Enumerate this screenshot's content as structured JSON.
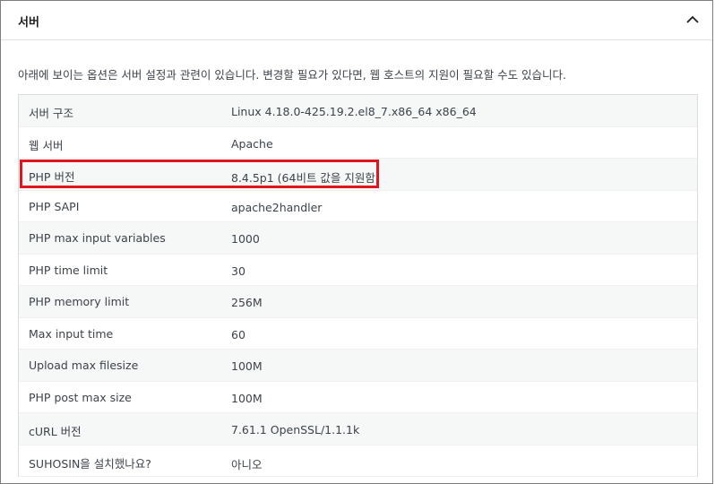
{
  "panel": {
    "title": "서버",
    "toggle_icon": "chevron-up-icon",
    "description": "아래에 보이는 옵션은 서버 설정과 관련이 있습니다. 변경할 필요가 있다면, 웹 호스트의 지원이 필요할 수도 있습니다."
  },
  "rows": [
    {
      "label": "서버 구조",
      "value": "Linux 4.18.0-425.19.2.el8_7.x86_64 x86_64"
    },
    {
      "label": "웹 서버",
      "value": "Apache"
    },
    {
      "label": "PHP 버전",
      "value": "8.4.5p1 (64비트 값을 지원함)"
    },
    {
      "label": "PHP SAPI",
      "value": "apache2handler"
    },
    {
      "label": "PHP max input variables",
      "value": "1000"
    },
    {
      "label": "PHP time limit",
      "value": "30"
    },
    {
      "label": "PHP memory limit",
      "value": "256M"
    },
    {
      "label": "Max input time",
      "value": "60"
    },
    {
      "label": "Upload max filesize",
      "value": "100M"
    },
    {
      "label": "PHP post max size",
      "value": "100M"
    },
    {
      "label": "cURL 버전",
      "value": "7.61.1 OpenSSL/1.1.1k"
    },
    {
      "label": "SUHOSIN을 설치했나요?",
      "value": "아니오"
    }
  ],
  "colors": {
    "highlight": "#e0161e",
    "row_alt": "#f6f7f7",
    "text": "#3c434a"
  }
}
